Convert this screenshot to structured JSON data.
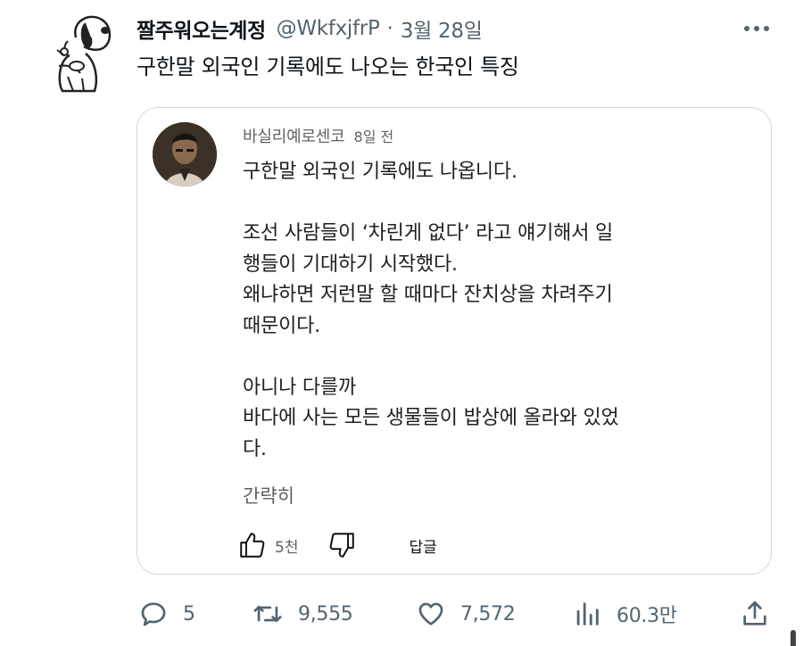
{
  "tweet": {
    "display_name": "짤주워오는계정",
    "handle": "@WkfxjfrP",
    "separator": "·",
    "date": "3월 28일",
    "text": "구한말 외국인 기록에도 나오는 한국인 특징"
  },
  "quoted_comment": {
    "author": "바실리예로센코",
    "time": "8일 전",
    "paragraphs": [
      "구한말 외국인 기록에도 나옵니다.",
      "조선 사람들이 ‘차린게 없다’ 라고 얘기해서 일\n행들이 기대하기 시작했다.\n왜냐하면 저런말 할 때마다 잔치상을 차려주기\n때문이다.",
      "아니나 다를까\n바다에 사는 모든 생물들이 밥상에 올라와 있었\n다."
    ],
    "more_label": "간략히",
    "like_count": "5천",
    "reply_label": "답글"
  },
  "actions": {
    "replies": "5",
    "retweets": "9,555",
    "likes": "7,572",
    "views": "60.3만"
  },
  "icons": [
    "more-icon",
    "thumbs-up-icon",
    "thumbs-down-icon",
    "reply-icon",
    "retweet-icon",
    "heart-icon",
    "views-icon",
    "share-icon"
  ],
  "colors": {
    "text": "#0f1419",
    "secondary": "#536471",
    "border": "#cfd9de"
  }
}
